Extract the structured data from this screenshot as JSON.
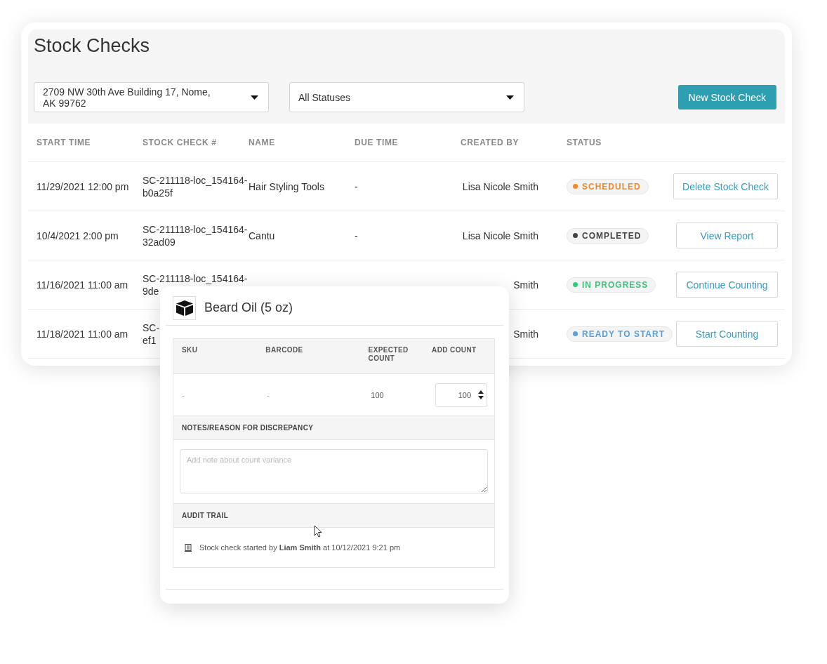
{
  "title": "Stock Checks",
  "filters": [
    {
      "value": "2709 NW 30th Ave Building 17, Nome, AK 99762"
    },
    {
      "value": "All Statuses"
    }
  ],
  "new_button": "New Stock Check",
  "table": {
    "columns": [
      "START TIME",
      "STOCK CHECK #",
      "NAME",
      "DUE TIME",
      "CREATED BY",
      "STATUS"
    ],
    "rows": [
      {
        "start_time": "11/29/2021 12:00 pm",
        "stock_check": [
          "SC-211118-loc_154164-",
          "b0a25f"
        ],
        "name": "Hair Styling Tools",
        "due_time": "-",
        "created_by": "Lisa Nicole Smith",
        "status": {
          "label": "SCHEDULED",
          "color": "#f0892e"
        },
        "action": "Delete Stock Check"
      },
      {
        "start_time": "10/4/2021 2:00 pm",
        "stock_check": [
          "SC-211118-loc_154164-",
          "32ad09"
        ],
        "name": "Cantu",
        "due_time": "-",
        "created_by": "Lisa Nicole Smith",
        "status": {
          "label": "COMPLETED",
          "color": "#444444"
        },
        "action": "View Report"
      },
      {
        "start_time": "11/16/2021 11:00 am",
        "stock_check": [
          "SC-211118-loc_154164-",
          "9de"
        ],
        "created_by": "Smith",
        "status": {
          "label": "IN PROGRESS",
          "color": "#3cc47c"
        },
        "action": "Continue Counting"
      },
      {
        "start_time": "11/18/2021 11:00 am",
        "stock_check": [
          "SC-",
          "ef1"
        ],
        "created_by": "Smith",
        "status": {
          "label": "READY TO START",
          "color": "#5a9fd8"
        },
        "action": "Start Counting"
      }
    ]
  },
  "item_card": {
    "title": "Beard Oil (5 oz)",
    "columns": [
      "SKU",
      "BARCODE",
      "EXPECTED COUNT",
      "ADD COUNT"
    ],
    "row": {
      "sku": "-",
      "barcode": "-",
      "expected": "100",
      "count": "100"
    },
    "notes_header": "NOTES/REASON FOR DISCREPANCY",
    "notes_placeholder": "Add note about count variance",
    "audit_header": "AUDIT TRAIL",
    "audit": [
      {
        "text": "Stock check started by **Liam Smith** at 10/12/2021 9:21 pm"
      }
    ]
  }
}
